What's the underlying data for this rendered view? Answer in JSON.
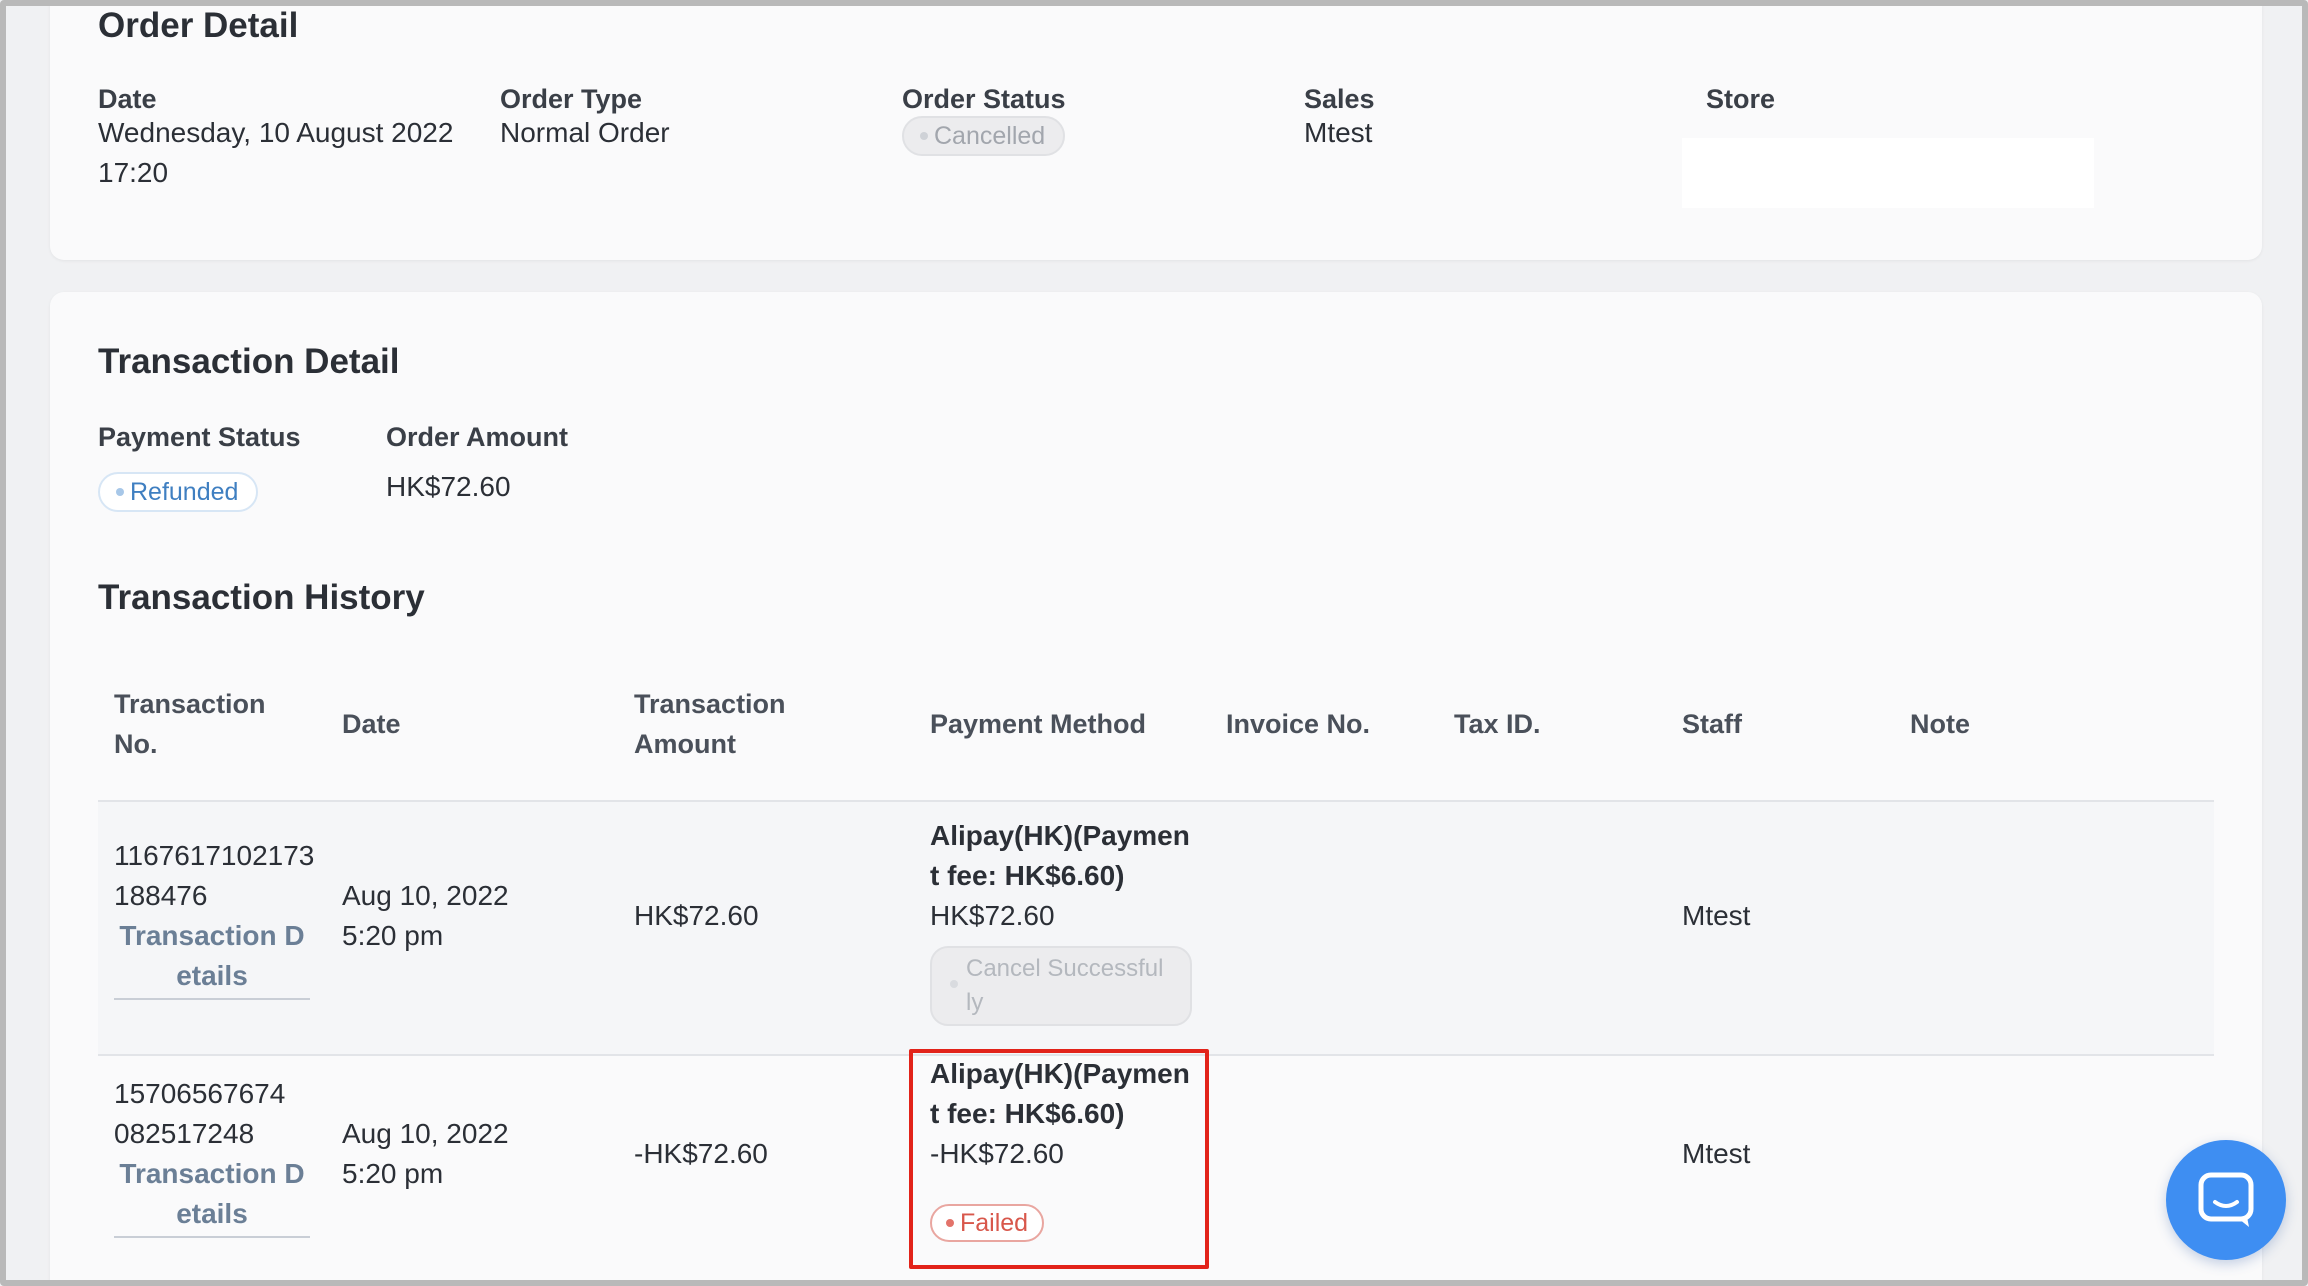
{
  "order_detail": {
    "title": "Order Detail",
    "date_label": "Date",
    "date_value_line1": "Wednesday, 10 August 2022",
    "date_value_line2": "17:20",
    "order_type_label": "Order Type",
    "order_type_value": "Normal Order",
    "order_status_label": "Order Status",
    "order_status_value": "Cancelled",
    "sales_label": "Sales",
    "sales_value": "Mtest",
    "store_label": "Store"
  },
  "transaction_detail": {
    "title": "Transaction Detail",
    "payment_status_label": "Payment Status",
    "payment_status_value": "Refunded",
    "order_amount_label": "Order Amount",
    "order_amount_value": "HK$72.60"
  },
  "transaction_history": {
    "title": "Transaction History",
    "columns": {
      "transaction_no_l1": "Transaction",
      "transaction_no_l2": "No.",
      "date": "Date",
      "amount_l1": "Transaction",
      "amount_l2": "Amount",
      "payment_method": "Payment Method",
      "invoice_no": "Invoice No.",
      "tax_id": "Tax ID.",
      "staff": "Staff",
      "note": "Note"
    },
    "rows": [
      {
        "no_l1": "1167617102173",
        "no_l2": "188476",
        "details_l1": "Transaction D",
        "details_l2": "etails",
        "date_l1": "Aug 10, 2022",
        "date_l2": "5:20 pm",
        "amount": "HK$72.60",
        "method_l1": "Alipay(HK)(Paymen",
        "method_l2": "t fee: HK$6.60)",
        "method_amount": "HK$72.60",
        "status_l1": "Cancel Successful",
        "status_l2": "ly",
        "staff": "Mtest"
      },
      {
        "no_l1": "15706567674",
        "no_l2": "082517248",
        "details_l1": "Transaction D",
        "details_l2": "etails",
        "date_l1": "Aug 10, 2022",
        "date_l2": "5:20 pm",
        "amount": "-HK$72.60",
        "method_l1": "Alipay(HK)(Paymen",
        "method_l2": "t fee: HK$6.60)",
        "method_amount": "-HK$72.60",
        "status": "Failed",
        "staff": "Mtest"
      }
    ]
  },
  "icons": {
    "chat": "chat-bubble-icon"
  },
  "colors": {
    "refunded": "#3f7fc1",
    "failed": "#d8574b",
    "highlight": "#e2231a",
    "chat": "#3e8ef2"
  }
}
